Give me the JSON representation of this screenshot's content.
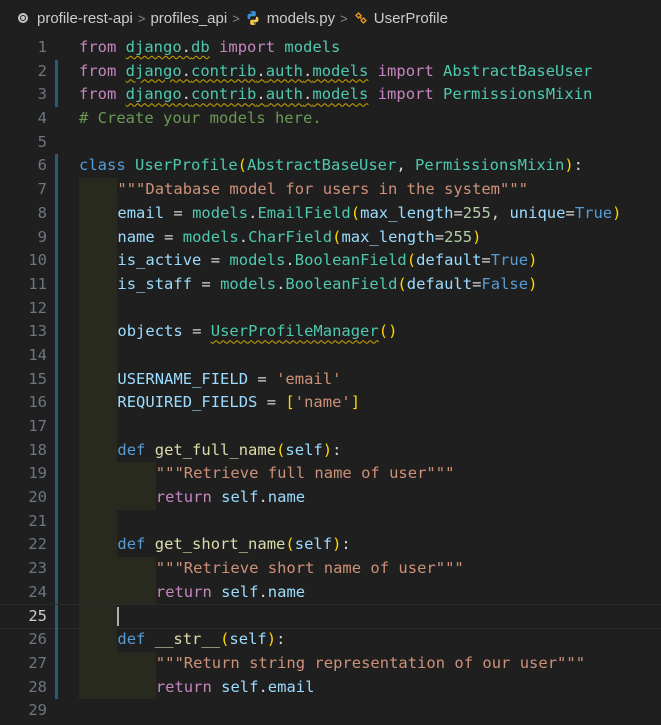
{
  "breadcrumb": {
    "project": "profile-rest-api",
    "folder": "profiles_api",
    "file": "models.py",
    "symbol": "UserProfile",
    "separator": ">"
  },
  "editor": {
    "current_line": 25,
    "lines": [
      {
        "n": 1,
        "text": "from django.db import models"
      },
      {
        "n": 2,
        "text": "from django.contrib.auth.models import AbstractBaseUser"
      },
      {
        "n": 3,
        "text": "from django.contrib.auth.models import PermissionsMixin"
      },
      {
        "n": 4,
        "text": "# Create your models here."
      },
      {
        "n": 5,
        "text": ""
      },
      {
        "n": 6,
        "text": "class UserProfile(AbstractBaseUser, PermissionsMixin):"
      },
      {
        "n": 7,
        "text": "    \"\"\"Database model for users in the system\"\"\""
      },
      {
        "n": 8,
        "text": "    email = models.EmailField(max_length=255, unique=True)"
      },
      {
        "n": 9,
        "text": "    name = models.CharField(max_length=255)"
      },
      {
        "n": 10,
        "text": "    is_active = models.BooleanField(default=True)"
      },
      {
        "n": 11,
        "text": "    is_staff = models.BooleanField(default=False)"
      },
      {
        "n": 12,
        "text": ""
      },
      {
        "n": 13,
        "text": "    objects = UserProfileManager()"
      },
      {
        "n": 14,
        "text": ""
      },
      {
        "n": 15,
        "text": "    USERNAME_FIELD = 'email'"
      },
      {
        "n": 16,
        "text": "    REQUIRED_FIELDS = ['name']"
      },
      {
        "n": 17,
        "text": ""
      },
      {
        "n": 18,
        "text": "    def get_full_name(self):"
      },
      {
        "n": 19,
        "text": "        \"\"\"Retrieve full name of user\"\"\""
      },
      {
        "n": 20,
        "text": "        return self.name"
      },
      {
        "n": 21,
        "text": ""
      },
      {
        "n": 22,
        "text": "    def get_short_name(self):"
      },
      {
        "n": 23,
        "text": "        \"\"\"Retrieve short name of user\"\"\""
      },
      {
        "n": 24,
        "text": "        return self.name"
      },
      {
        "n": 25,
        "text": ""
      },
      {
        "n": 26,
        "text": "    def __str__(self):"
      },
      {
        "n": 27,
        "text": "        \"\"\"Return string representation of our user\"\"\""
      },
      {
        "n": 28,
        "text": "        return self.email"
      },
      {
        "n": 29,
        "text": ""
      }
    ]
  },
  "icons": {
    "project": "source-control-circle-icon",
    "file": "python-file-icon",
    "symbol": "class-symbol-icon"
  },
  "colors": {
    "background": "#1f1f1f",
    "keyword": "#c586c0",
    "storage": "#569cd6",
    "type": "#4ec9b0",
    "function": "#dcdcaa",
    "variable": "#9cdcfe",
    "string": "#ce9178",
    "comment": "#6a9955",
    "bracket_1": "#ffd700",
    "bracket_2": "#da70d6"
  }
}
